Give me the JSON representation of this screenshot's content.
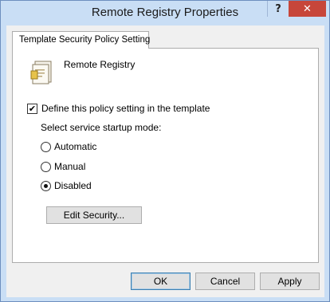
{
  "window": {
    "title": "Remote Registry Properties",
    "help_glyph": "?",
    "close_glyph": "✕"
  },
  "tab": {
    "label": "Template Security Policy Setting"
  },
  "service": {
    "icon": "service-document-icon",
    "name": "Remote Registry"
  },
  "define_policy": {
    "label": "Define this policy setting in the template",
    "checked": true,
    "check_glyph": "✔"
  },
  "startup_mode": {
    "label": "Select service startup mode:",
    "options": [
      {
        "label": "Automatic",
        "selected": false
      },
      {
        "label": "Manual",
        "selected": false
      },
      {
        "label": "Disabled",
        "selected": true
      }
    ]
  },
  "buttons": {
    "edit_security": "Edit Security...",
    "ok": "OK",
    "cancel": "Cancel",
    "apply": "Apply"
  },
  "colors": {
    "titlebar": "#c9def5",
    "close_button": "#c7463a",
    "dialog_face": "#f0f0f0"
  }
}
